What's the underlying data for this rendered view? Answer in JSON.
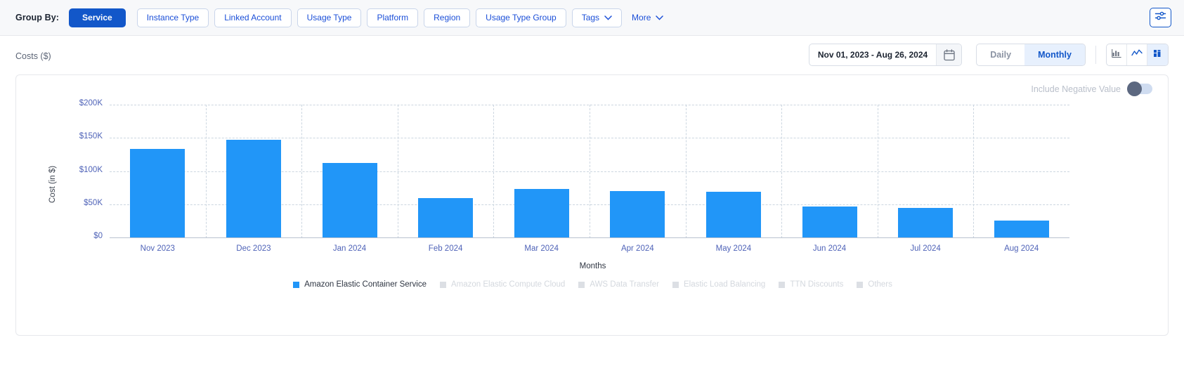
{
  "groupby": {
    "label": "Group By:",
    "active": {
      "label": "Service",
      "name": "service"
    },
    "chips": [
      {
        "label": "Instance Type",
        "name": "instance-type",
        "dropdown": false
      },
      {
        "label": "Linked Account",
        "name": "linked-account",
        "dropdown": false
      },
      {
        "label": "Usage Type",
        "name": "usage-type",
        "dropdown": false
      },
      {
        "label": "Platform",
        "name": "platform",
        "dropdown": false
      },
      {
        "label": "Region",
        "name": "region",
        "dropdown": false
      },
      {
        "label": "Usage Type Group",
        "name": "usage-type-group",
        "dropdown": false
      },
      {
        "label": "Tags",
        "name": "tags",
        "dropdown": true
      }
    ],
    "more_label": "More",
    "settings_icon": "sliders-icon"
  },
  "controls": {
    "costs_label": "Costs ($)",
    "date_range": "Nov 01, 2023 - Aug 26, 2024",
    "calendar_icon": "calendar-icon",
    "granularity": {
      "options": [
        {
          "label": "Daily",
          "name": "daily",
          "active": false
        },
        {
          "label": "Monthly",
          "name": "monthly",
          "active": true
        }
      ]
    },
    "chart_types": [
      {
        "name": "bar-chart-icon",
        "active": false
      },
      {
        "name": "line-chart-icon",
        "active": false
      },
      {
        "name": "stacked-bar-chart-icon",
        "active": true
      }
    ]
  },
  "chart_card": {
    "negative_toggle_label": "Include Negative Value",
    "negative_toggle_on": false
  },
  "chart_data": {
    "type": "bar",
    "title": "",
    "xlabel": "Months",
    "ylabel": "Cost (in $)",
    "categories": [
      "Nov 2023",
      "Dec 2023",
      "Jan 2024",
      "Feb 2024",
      "Mar 2024",
      "Apr 2024",
      "May 2024",
      "Jun 2024",
      "Jul 2024",
      "Aug 2024"
    ],
    "series": [
      {
        "name": "Amazon Elastic Container Service",
        "color": "#2196f8",
        "values": [
          133000,
          147000,
          112000,
          59000,
          73000,
          70000,
          69000,
          47000,
          44000,
          25000
        ]
      }
    ],
    "ylim": [
      0,
      200000
    ],
    "yticks": [
      "$0",
      "$50K",
      "$100K",
      "$150K",
      "$200K"
    ],
    "ytick_values": [
      0,
      50000,
      100000,
      150000,
      200000
    ],
    "grid": true,
    "legend_position": "bottom",
    "legend": [
      {
        "label": "Amazon Elastic Container Service",
        "active": true,
        "color": "#2196f8"
      },
      {
        "label": "Amazon Elastic Compute Cloud",
        "active": false,
        "color": "#dcdfe4"
      },
      {
        "label": "AWS Data Transfer",
        "active": false,
        "color": "#dcdfe4"
      },
      {
        "label": "Elastic Load Balancing",
        "active": false,
        "color": "#dcdfe4"
      },
      {
        "label": "TTN Discounts",
        "active": false,
        "color": "#dcdfe4"
      },
      {
        "label": "Others",
        "active": false,
        "color": "#dcdfe4"
      }
    ]
  }
}
